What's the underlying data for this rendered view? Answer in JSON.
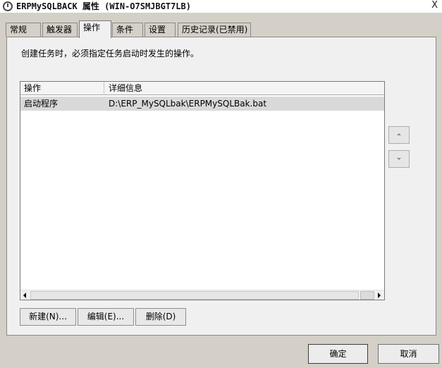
{
  "window": {
    "title": "ERPMySQLBACK 属性 (WIN-O7SMJBGT7LB)",
    "close_glyph": "X"
  },
  "tabs": [
    {
      "label": "常规",
      "active": false
    },
    {
      "label": "触发器",
      "active": false
    },
    {
      "label": "操作",
      "active": true
    },
    {
      "label": "条件",
      "active": false
    },
    {
      "label": "设置",
      "active": false
    },
    {
      "label": "历史记录(已禁用)",
      "active": false
    }
  ],
  "panel": {
    "description": "创建任务时，必须指定任务启动时发生的操作。"
  },
  "actions_list": {
    "columns": [
      "操作",
      "详细信息"
    ],
    "rows": [
      {
        "action": "启动程序",
        "details": "D:\\ERP_MySQLbak\\ERPMySQLBak.bat",
        "selected": true
      }
    ]
  },
  "buttons": {
    "new": "新建(N)...",
    "edit": "编辑(E)...",
    "delete": "删除(D)",
    "ok": "确定",
    "cancel": "取消"
  },
  "icons": {
    "title": "task-scheduler-icon",
    "move_up": "arrow-up-icon",
    "move_down": "arrow-down-icon",
    "scroll_left": "arrow-left-icon",
    "scroll_right": "arrow-right-icon"
  },
  "colors": {
    "dialog_bg": "#d4d0c8",
    "panel_bg": "#f0f0f0",
    "selected_row": "#d9d9d9"
  }
}
